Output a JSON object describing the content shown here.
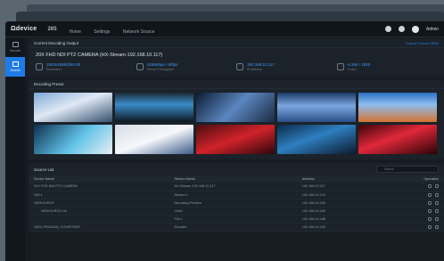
{
  "header": {
    "brand": "Ωdevice",
    "device": "265",
    "nav": [
      "Home",
      "Settings",
      "Network Source"
    ],
    "user": "Admin"
  },
  "sidebar": {
    "items": [
      {
        "label": "Decode"
      },
      {
        "label": "Source"
      }
    ]
  },
  "current": {
    "title": "Current Decoding Output",
    "output_link": "Output Format HDMI",
    "camera": "20X FHD NDI PTZ CAMERA (HX-Stream-192.168.10.117)",
    "stats": [
      {
        "value": "1920x1080@60.00",
        "label": "Resolution"
      },
      {
        "value": "4150Kbps / 60fps",
        "label": "Stream Throughput"
      },
      {
        "value": "192.168.10.117",
        "label": "IP Address"
      },
      {
        "value": "H.264 / 1920",
        "label": "Codec"
      }
    ]
  },
  "presets": {
    "title": "Decoding Preset",
    "thumbs": [
      "t1",
      "t2",
      "t3",
      "t4",
      "t5",
      "t6",
      "t7",
      "t8",
      "t9",
      "t10"
    ]
  },
  "sources": {
    "title": "Source List",
    "search_placeholder": "Search",
    "columns": [
      "Device Name",
      "Stream Name",
      "Address",
      "Operation"
    ],
    "rows": [
      {
        "name": "20X FHD NDI PTZ CAMERA",
        "stream": "HX-Stream-192.168.10.117",
        "address": "192.168.10.117",
        "indent": false
      },
      {
        "name": "NDI-1",
        "stream": "Stream 1",
        "address": "192.168.10.121",
        "indent": false
      },
      {
        "name": "NDISOURCE",
        "stream": "Decoding Preview",
        "address": "192.168.10.200",
        "indent": false
      },
      {
        "name": "NDISOURCE-HX",
        "stream": "Chart",
        "address": "192.168.10.189",
        "indent": true
      },
      {
        "name": "",
        "stream": "FULL",
        "address": "192.168.10.188",
        "indent": false
      },
      {
        "name": "NDIX-PROD265_COMPOSER",
        "stream": "Encoder",
        "address": "192.168.10.150",
        "indent": false
      }
    ]
  },
  "colors": {
    "accent": "#1f7be8",
    "value": "#3d9bff"
  }
}
